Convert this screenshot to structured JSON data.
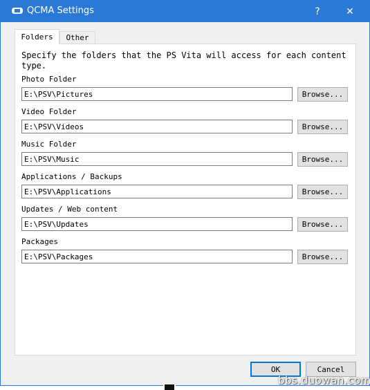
{
  "window": {
    "title": "QCMA Settings",
    "help_glyph": "?",
    "close_glyph": "✕",
    "accent_color": "#2b79d6"
  },
  "tabs": [
    {
      "label": "Folders",
      "active": true
    },
    {
      "label": "Other",
      "active": false
    }
  ],
  "description": "Specify the folders that the PS Vita will access for each content type.",
  "fields": [
    {
      "label": "Photo Folder",
      "value": "E:\\PSV\\Pictures",
      "browse_label": "Browse..."
    },
    {
      "label": "Video Folder",
      "value": "E:\\PSV\\Videos",
      "browse_label": "Browse..."
    },
    {
      "label": "Music Folder",
      "value": "E:\\PSV\\Music",
      "browse_label": "Browse..."
    },
    {
      "label": "Applications / Backups",
      "value": "E:\\PSV\\Applications",
      "browse_label": "Browse..."
    },
    {
      "label": "Updates / Web content",
      "value": "E:\\PSV\\Updates",
      "browse_label": "Browse..."
    },
    {
      "label": "Packages",
      "value": "E:\\PSV\\Packages",
      "browse_label": "Browse..."
    }
  ],
  "buttons": {
    "ok_label": "OK",
    "cancel_label": "Cancel"
  },
  "watermark": "bbs.duowan.com"
}
